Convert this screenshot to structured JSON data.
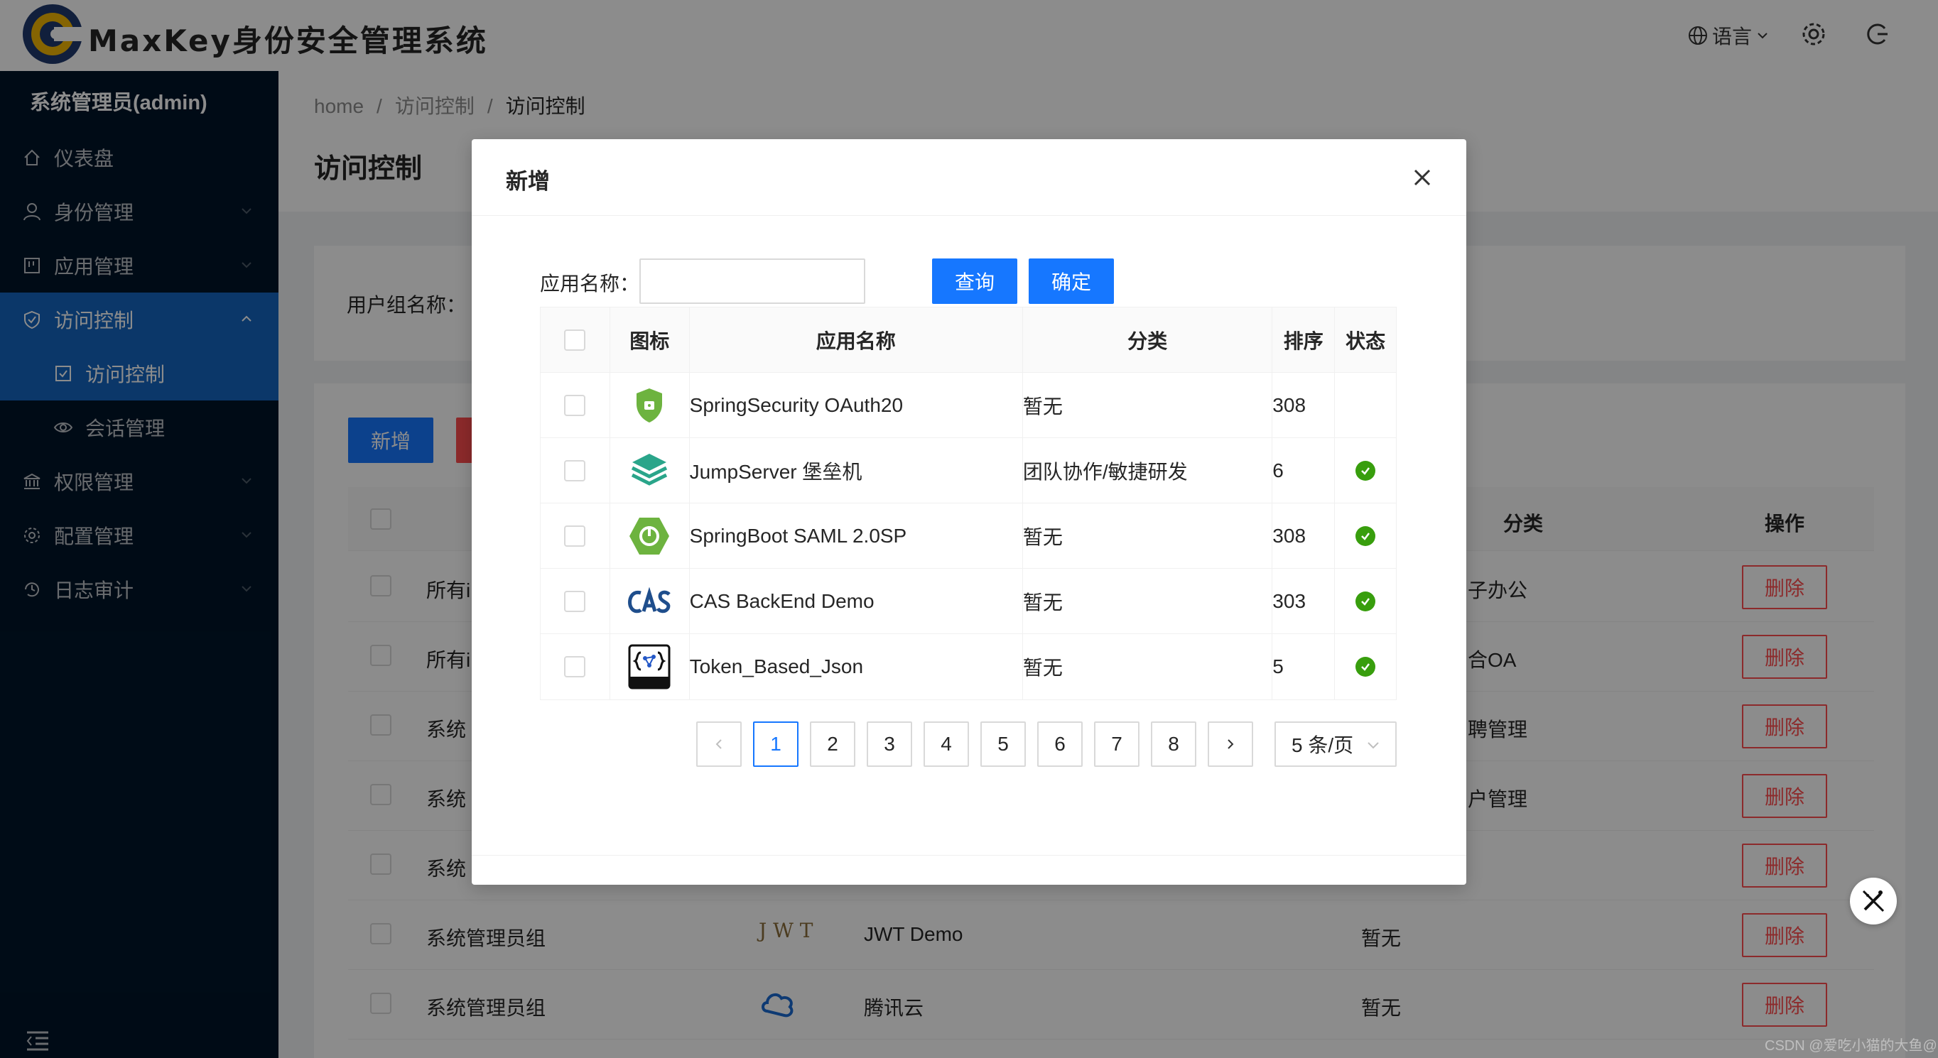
{
  "header": {
    "brand": "MaxKey身份安全管理系统",
    "lang_label": "语言"
  },
  "sidebar": {
    "user": "系统管理员(admin)",
    "items": [
      {
        "label": "仪表盘",
        "icon": "home-icon"
      },
      {
        "label": "身份管理",
        "icon": "user-icon"
      },
      {
        "label": "应用管理",
        "icon": "app-icon"
      },
      {
        "label": "访问控制",
        "icon": "shield-icon"
      },
      {
        "label": "访问控制",
        "icon": "check-square-icon"
      },
      {
        "label": "会话管理",
        "icon": "eye-icon"
      },
      {
        "label": "权限管理",
        "icon": "bank-icon"
      },
      {
        "label": "配置管理",
        "icon": "gear-icon"
      },
      {
        "label": "日志审计",
        "icon": "history-icon"
      }
    ]
  },
  "breadcrumb": [
    "home",
    "访问控制",
    "访问控制"
  ],
  "page_title": "访问控制",
  "search": {
    "label": "用户组名称："
  },
  "list": {
    "add_label": "新增",
    "headers": {
      "category": "分类",
      "action": "操作"
    },
    "rows": [
      {
        "group": "所有i",
        "category": "子办公"
      },
      {
        "group": "所有i",
        "category": "合OA"
      },
      {
        "group": "系统",
        "category": "聘管理"
      },
      {
        "group": "系统",
        "category": "户管理"
      },
      {
        "group": "系统",
        "category": ""
      },
      {
        "group": "系统管理员组",
        "app": "JWT Demo",
        "category": "暂无"
      },
      {
        "group": "系统管理员组",
        "app": "腾讯云",
        "category": "暂无"
      }
    ],
    "delete_label": "删除"
  },
  "modal": {
    "title": "新增",
    "filter_label": "应用名称：",
    "filter_value": "",
    "query_label": "查询",
    "confirm_label": "确定",
    "columns": [
      "图标",
      "应用名称",
      "分类",
      "排序",
      "状态"
    ],
    "rows": [
      {
        "icon": "spring-security-icon",
        "name": "SpringSecurity OAuth20",
        "category": "暂无",
        "sort": "308",
        "status": ""
      },
      {
        "icon": "jumpserver-icon",
        "name": "JumpServer 堡垒机",
        "category": "团队协作/敏捷研发",
        "sort": "6",
        "status": "active"
      },
      {
        "icon": "springboot-icon",
        "name": "SpringBoot SAML 2.0SP",
        "category": "暂无",
        "sort": "308",
        "status": "active"
      },
      {
        "icon": "cas-icon",
        "name": "CAS BackEnd Demo",
        "category": "暂无",
        "sort": "303",
        "status": "active"
      },
      {
        "icon": "json-icon",
        "name": "Token_Based_Json",
        "category": "暂无",
        "sort": "5",
        "status": "active"
      }
    ],
    "pagination": {
      "pages": [
        "1",
        "2",
        "3",
        "4",
        "5",
        "6",
        "7",
        "8"
      ],
      "current": "1",
      "page_size": "5 条/页"
    }
  },
  "watermark": "CSDN @爱吃小猫的大鱼@"
}
